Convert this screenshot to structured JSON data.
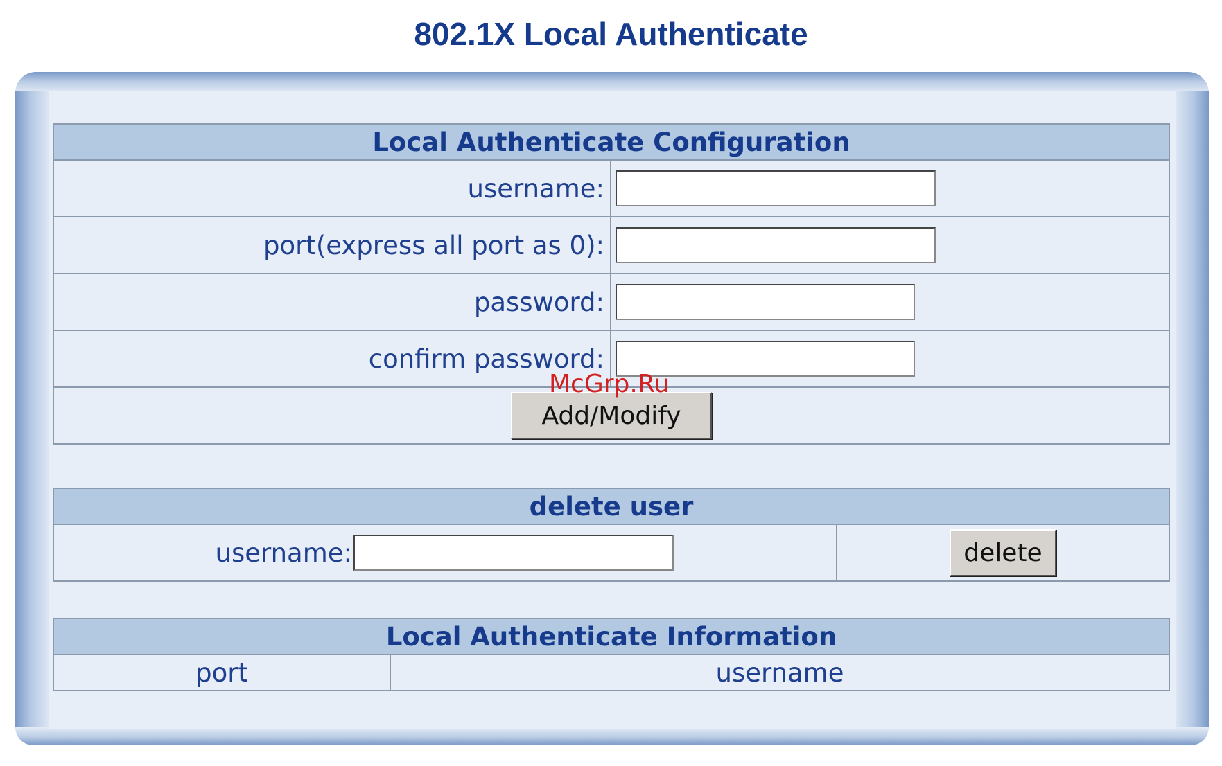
{
  "page": {
    "title": "802.1X Local Authenticate"
  },
  "config": {
    "header": "Local Authenticate Configuration",
    "username_label": "username:",
    "port_label": "port(express all port as 0):",
    "password_label": "password:",
    "confirm_label": "confirm password:",
    "username_value": "",
    "port_value": "",
    "password_value": "",
    "confirm_value": "",
    "submit_label": "Add/Modify"
  },
  "delete_user": {
    "header": "delete user",
    "username_label": "username:",
    "username_value": "",
    "button_label": "delete"
  },
  "info": {
    "header": "Local Authenticate Information",
    "columns": [
      "port",
      "username"
    ]
  },
  "watermark": {
    "text": "McGrp.Ru"
  }
}
